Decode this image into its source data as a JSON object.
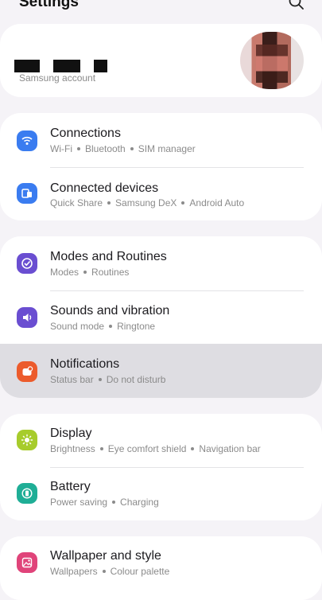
{
  "header": {
    "title": "Settings",
    "search_icon": "search-icon"
  },
  "account": {
    "subtitle": "Samsung account"
  },
  "colors": {
    "connections": "#3a7cf0",
    "connected_devices": "#3a7cf0",
    "modes": "#6a4ed1",
    "sounds": "#6a4ed1",
    "notifications": "#ec5b2c",
    "display": "#a7cc2c",
    "battery": "#1fae96",
    "wallpaper": "#e0447a"
  },
  "items": [
    {
      "label": "Connections",
      "sub": [
        "Wi-Fi",
        "Bluetooth",
        "SIM manager"
      ],
      "icon": "wifi-icon"
    },
    {
      "label": "Connected devices",
      "sub": [
        "Quick Share",
        "Samsung DeX",
        "Android Auto"
      ],
      "icon": "devices-icon"
    },
    {
      "label": "Modes and Routines",
      "sub": [
        "Modes",
        "Routines"
      ],
      "icon": "check-circle-icon"
    },
    {
      "label": "Sounds and vibration",
      "sub": [
        "Sound mode",
        "Ringtone"
      ],
      "icon": "speaker-icon"
    },
    {
      "label": "Notifications",
      "sub": [
        "Status bar",
        "Do not disturb"
      ],
      "icon": "notification-icon"
    },
    {
      "label": "Display",
      "sub": [
        "Brightness",
        "Eye comfort shield",
        "Navigation bar"
      ],
      "icon": "sun-icon"
    },
    {
      "label": "Battery",
      "sub": [
        "Power saving",
        "Charging"
      ],
      "icon": "battery-icon"
    },
    {
      "label": "Wallpaper and style",
      "sub": [
        "Wallpapers",
        "Colour palette"
      ],
      "icon": "image-icon"
    }
  ]
}
